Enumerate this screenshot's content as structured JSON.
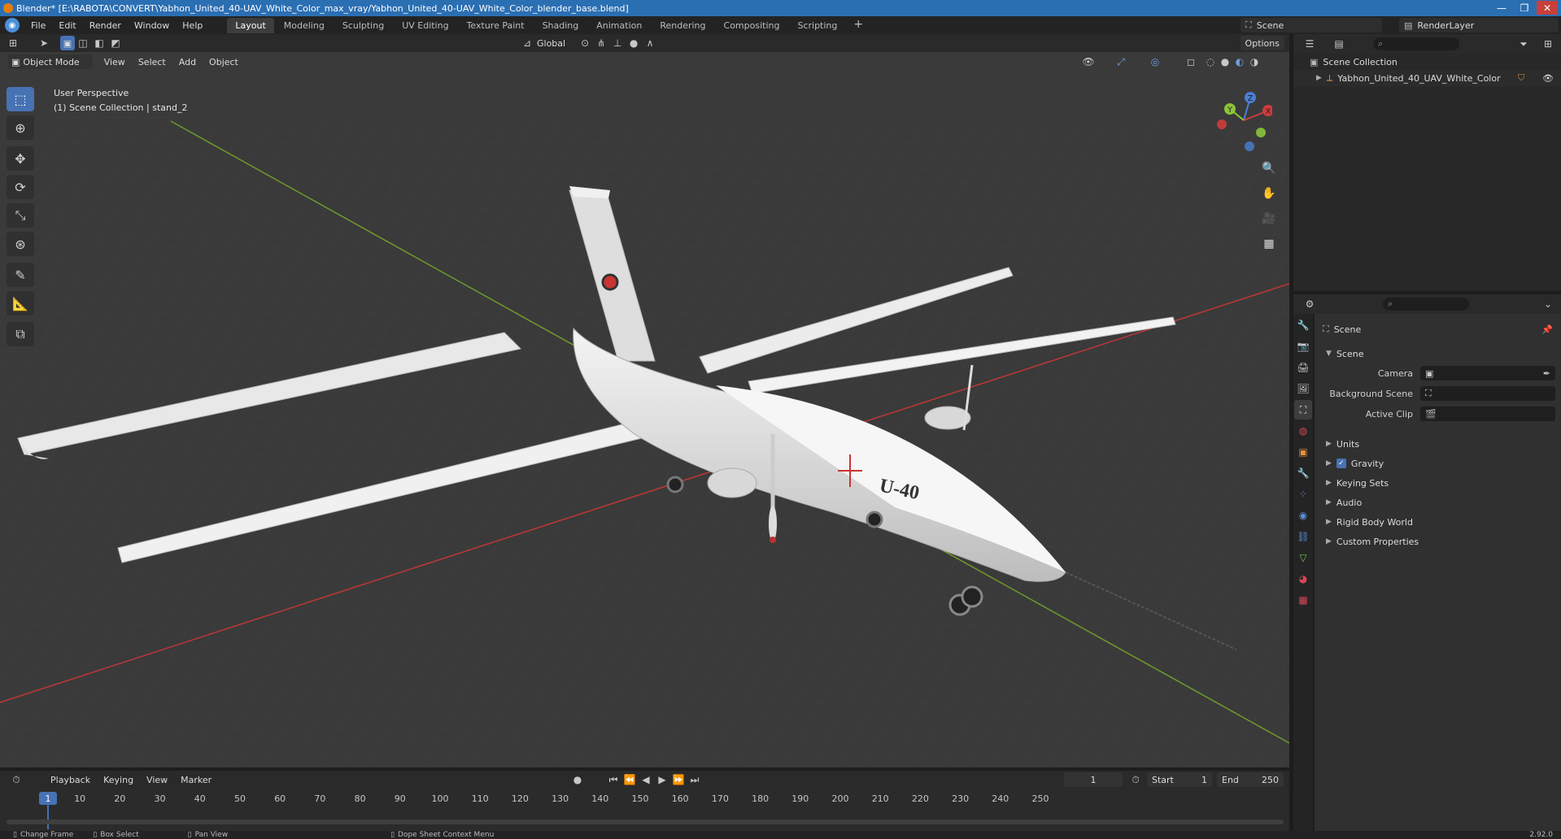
{
  "window": {
    "title": "Blender* [E:\\RABOTA\\CONVERT\\Yabhon_United_40-UAV_White_Color_max_vray/Yabhon_United_40-UAV_White_Color_blender_base.blend]",
    "controls": [
      "—",
      "❐",
      "✕"
    ]
  },
  "menu": {
    "items": [
      "File",
      "Edit",
      "Render",
      "Window",
      "Help"
    ],
    "workspaces": [
      "Layout",
      "Modeling",
      "Sculpting",
      "UV Editing",
      "Texture Paint",
      "Shading",
      "Animation",
      "Rendering",
      "Compositing",
      "Scripting"
    ],
    "active_workspace": "Layout",
    "add_symbol": "+",
    "scene": "Scene",
    "render_layer": "RenderLayer"
  },
  "viewport_header": {
    "transform_orientation": "Global",
    "options": "Options",
    "mode": "Object Mode",
    "menus": [
      "View",
      "Select",
      "Add",
      "Object"
    ]
  },
  "viewport": {
    "perspective": "User Perspective",
    "collection_info": "(1) Scene Collection | stand_2",
    "model_text": "U-40",
    "gizmo_axes": [
      "X",
      "Y",
      "Z"
    ]
  },
  "outliner": {
    "root": "Scene Collection",
    "items": [
      "Yabhon_United_40_UAV_White_Color"
    ]
  },
  "properties": {
    "context": "Scene",
    "panel": "Scene",
    "fields": [
      {
        "label": "Camera",
        "value": ""
      },
      {
        "label": "Background Scene",
        "value": ""
      },
      {
        "label": "Active Clip",
        "value": ""
      }
    ],
    "sections": [
      "Units",
      "Gravity",
      "Keying Sets",
      "Audio",
      "Rigid Body World",
      "Custom Properties"
    ],
    "gravity_checked": true
  },
  "timeline": {
    "menus": [
      "Playback",
      "Keying",
      "View",
      "Marker"
    ],
    "current_frame": "1",
    "start_label": "Start",
    "start": "1",
    "end_label": "End",
    "end": "250",
    "ticks": [
      "1",
      "10",
      "20",
      "30",
      "40",
      "50",
      "60",
      "70",
      "80",
      "90",
      "100",
      "110",
      "120",
      "130",
      "140",
      "150",
      "160",
      "170",
      "180",
      "190",
      "200",
      "210",
      "220",
      "230",
      "240",
      "250"
    ]
  },
  "statusbar": {
    "items": [
      "Change Frame",
      "Box Select",
      "Pan View",
      "Dope Sheet Context Menu"
    ],
    "version": "2.92.0"
  },
  "colors": {
    "accent": "#4772b3",
    "titlebar": "#2b6fb3",
    "x_axis": "#d03c3c",
    "y_axis": "#8bc43a"
  }
}
